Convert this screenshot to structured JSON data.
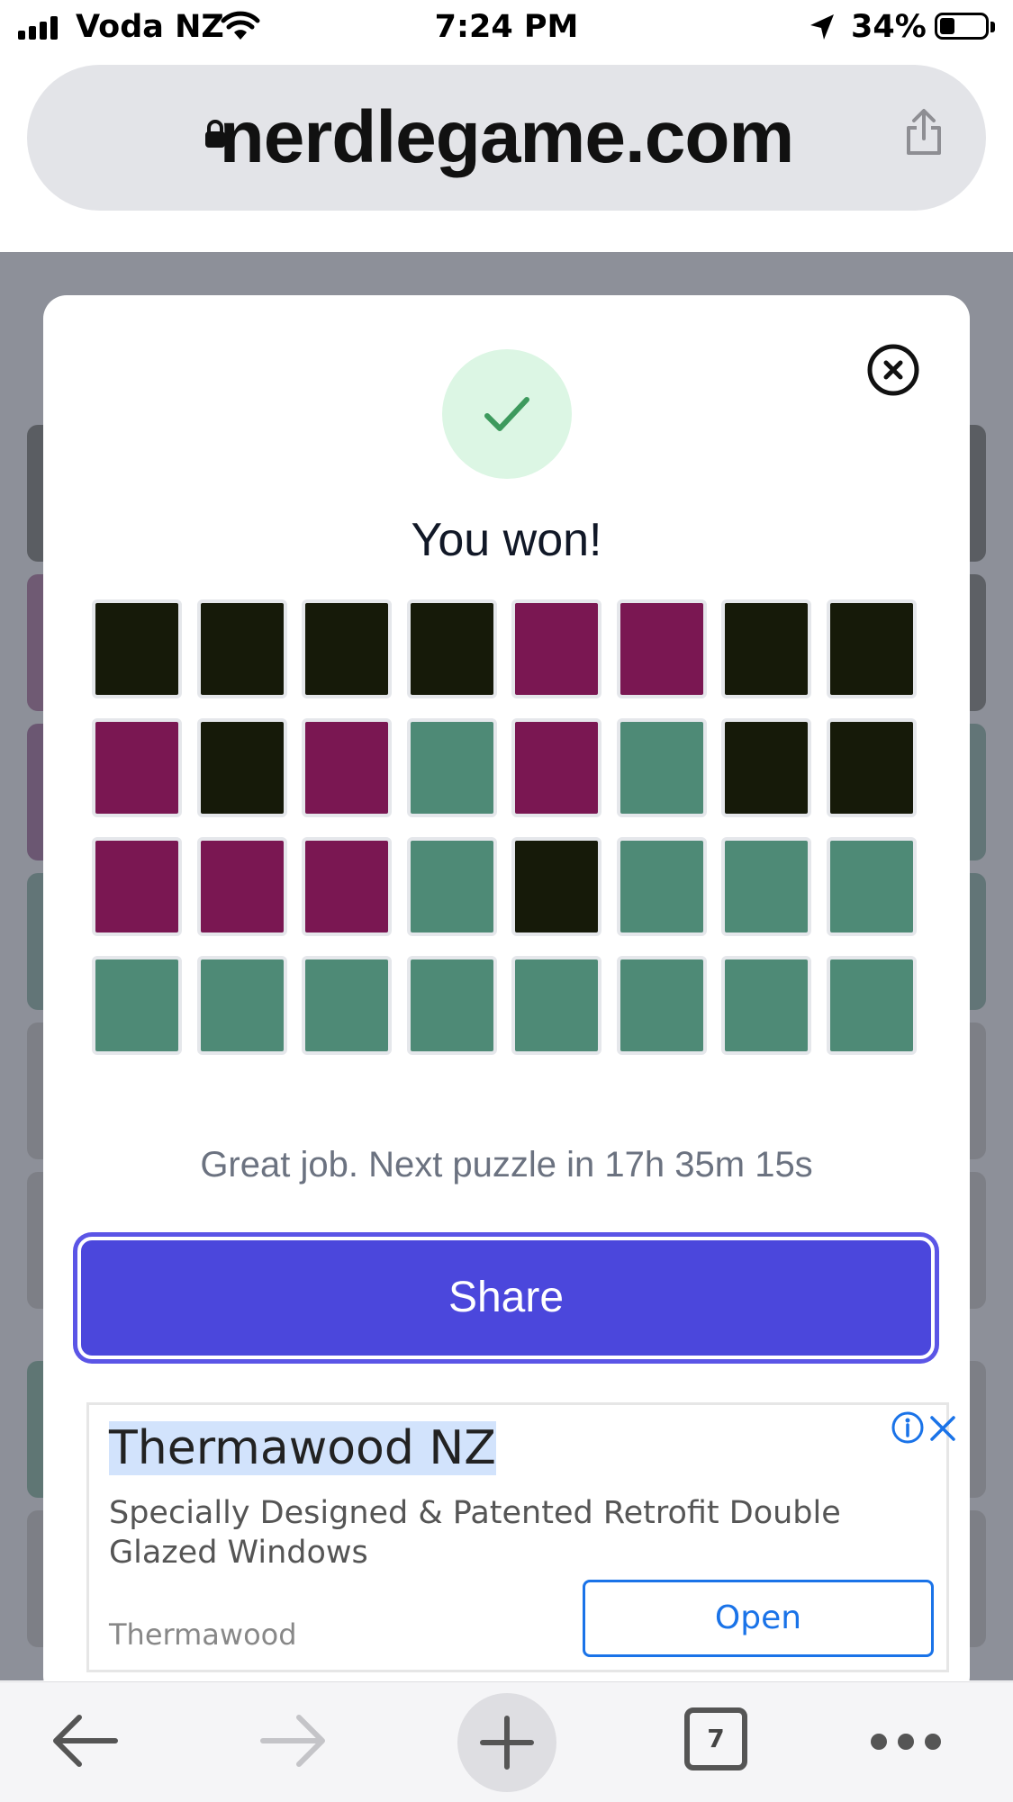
{
  "status_bar": {
    "carrier": "Voda NZ",
    "time": "7:24 PM",
    "battery_percent": "34%"
  },
  "browser": {
    "url": "nerdlegame.com",
    "open_tabs": "7"
  },
  "modal": {
    "title": "You won!",
    "grid": [
      [
        "black",
        "black",
        "black",
        "black",
        "purple",
        "purple",
        "black",
        "black"
      ],
      [
        "purple",
        "black",
        "purple",
        "green",
        "purple",
        "green",
        "black",
        "black"
      ],
      [
        "purple",
        "purple",
        "purple",
        "green",
        "black",
        "green",
        "green",
        "green"
      ],
      [
        "green",
        "green",
        "green",
        "green",
        "green",
        "green",
        "green",
        "green"
      ]
    ],
    "message": "Great job. Next puzzle in 17h 35m 15s",
    "share_label": "Share"
  },
  "ad": {
    "title": "Thermawood NZ",
    "description": "Specially Designed & Patented Retrofit Double Glazed Windows",
    "advertiser": "Thermawood",
    "cta_label": "Open"
  },
  "colors": {
    "black": "#161a09",
    "purple": "#7a1752",
    "green": "#4e8a76",
    "share_button": "#4b47dc",
    "ad_link": "#1a73e8"
  },
  "icons": [
    "signal-icon",
    "wifi-icon",
    "location-arrow-icon",
    "battery-icon",
    "lock-icon",
    "share-icon",
    "close-icon",
    "check-icon",
    "info-icon",
    "ad-close-icon",
    "back-icon",
    "forward-icon",
    "plus-icon",
    "more-icon"
  ]
}
